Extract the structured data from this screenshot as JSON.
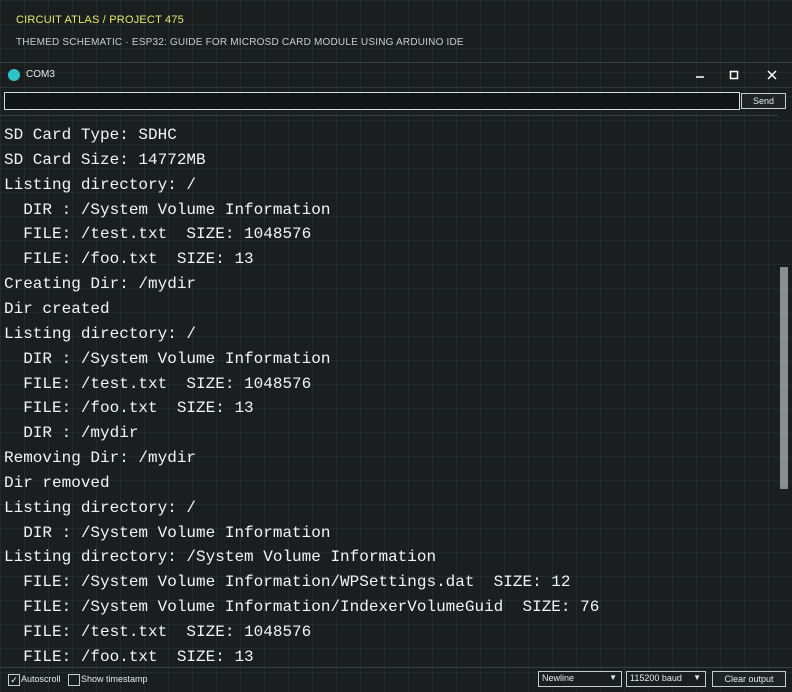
{
  "header": {
    "brand": "CIRCUIT ATLAS / PROJECT 475",
    "subtitle": "THEMED SCHEMATIC · ESP32: GUIDE FOR MICROSD CARD MODULE USING ARDUINO IDE"
  },
  "window": {
    "title": "COM3",
    "icon": "serial-port-icon",
    "controls": {
      "minimize": "—",
      "maximize": "☐",
      "close": "✕"
    }
  },
  "input": {
    "value": "",
    "send_label": "Send"
  },
  "output": {
    "lines": [
      "SD Card Type: SDHC",
      "SD Card Size: 14772MB",
      "Listing directory: /",
      "  DIR : /System Volume Information",
      "  FILE: /test.txt  SIZE: 1048576",
      "  FILE: /foo.txt  SIZE: 13",
      "Creating Dir: /mydir",
      "Dir created",
      "Listing directory: /",
      "  DIR : /System Volume Information",
      "  FILE: /test.txt  SIZE: 1048576",
      "  FILE: /foo.txt  SIZE: 13",
      "  DIR : /mydir",
      "Removing Dir: /mydir",
      "Dir removed",
      "Listing directory: /",
      "  DIR : /System Volume Information",
      "Listing directory: /System Volume Information",
      "  FILE: /System Volume Information/WPSettings.dat  SIZE: 12",
      "  FILE: /System Volume Information/IndexerVolumeGuid  SIZE: 76",
      "  FILE: /test.txt  SIZE: 1048576",
      "  FILE: /foo.txt  SIZE: 13"
    ]
  },
  "footer": {
    "autoscroll_label": "Autoscroll",
    "autoscroll_checked": true,
    "timestamp_label": "Show timestamp",
    "timestamp_checked": false,
    "line_ending": "Newline",
    "baud_rate": "115200 baud",
    "clear_label": "Clear output"
  },
  "colors": {
    "background": "#1b1e1f",
    "brand": "#e6e86a",
    "icon_accent": "#2fc3c8",
    "text": "#f2f5f4"
  }
}
